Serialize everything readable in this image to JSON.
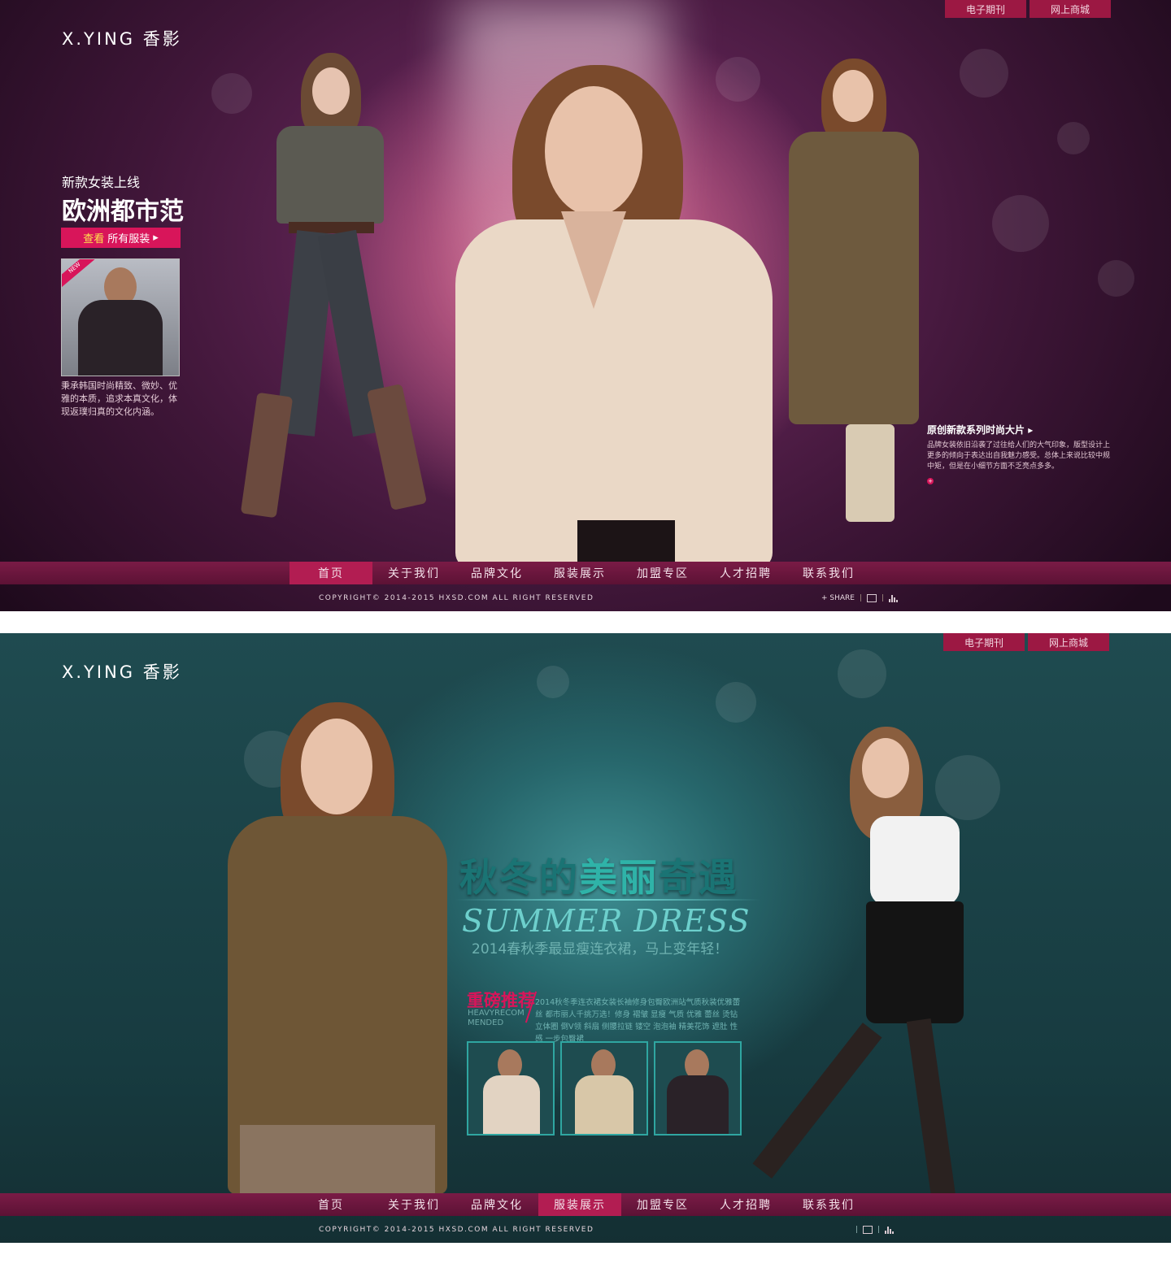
{
  "logo": "X.YING 香影",
  "top_links": [
    "电子期刊",
    "网上商城"
  ],
  "nav_items": [
    "首页",
    "关于我们",
    "品牌文化",
    "服装展示",
    "加盟专区",
    "人才招聘",
    "联系我们"
  ],
  "copyright": "COPYRIGHT© 2014-2015 HXSD.COM ALL RIGHT RESERVED",
  "share_label": "SHARE",
  "panel1": {
    "active_nav": "首页",
    "promo_subtitle": "新款女装上线",
    "promo_title": "欧洲都市范",
    "promo_button_highlight": "查看",
    "promo_button_text": "所有服装",
    "thumb_badge": "NEW",
    "promo_desc": "秉承韩国时尚精致、微妙、优雅的本质，追求本真文化，体现返璞归真的文化内涵。",
    "right_title": "原创新款系列时尚大片",
    "right_desc": "品牌女装依旧沿袭了过往给人们的大气印象，版型设计上更多的倾向于表达出自我魅力感受。总体上来说比较中规中矩，但是在小细节方面不乏亮点多多。"
  },
  "panel2": {
    "active_nav": "服装展示",
    "headline_a": "秋冬的",
    "headline_b": "美丽",
    "headline_c": "奇遇",
    "english_title": "SUMMER DRESS",
    "subheadline": "2014春秋季最显瘦连衣裙，马上变年轻！",
    "rec_title": "重磅推荐",
    "rec_english": "HEAVYRECOM MENDED",
    "rec_desc": "2014秋冬季连衣裙女装长袖修身包臀欧洲站气质秋装优雅蕾丝 都市丽人千挑万选！修身 褶皱 显瘦 气质 优雅 蕾丝 烫钻 立体圈 倒V领 斜扇 侧腰拉链 镂空 泡泡袖 精美花饰 遮肚 性感 一步包臀裙"
  },
  "colors": {
    "accent": "#d8155a",
    "nav_bg": "#6a1640",
    "panel1_bg": "#3f1638",
    "panel2_bg": "#1f4b50",
    "teal_text": "#6dcfcc"
  }
}
